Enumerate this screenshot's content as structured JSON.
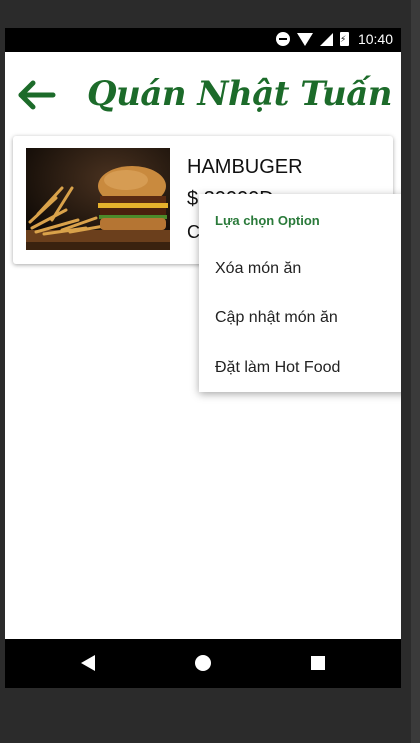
{
  "status_bar": {
    "time": "10:40"
  },
  "header": {
    "title": "Quán Nhật Tuấn",
    "back_icon": "arrow-left-icon",
    "accent_color": "#1c6b2a"
  },
  "food_item": {
    "name": "HAMBUGER",
    "price_prefix": "$",
    "price_hidden": "30000D",
    "category_initial": "C",
    "image": "burger-fries-photo"
  },
  "context_menu": {
    "header": "Lựa chọn Option",
    "items": [
      {
        "label": "Xóa món ăn"
      },
      {
        "label": "Cập nhật món ăn"
      },
      {
        "label": "Đặt làm Hot Food"
      }
    ]
  },
  "nav_bar": {
    "icons": [
      "back-triangle-icon",
      "home-circle-icon",
      "recent-square-icon"
    ]
  }
}
